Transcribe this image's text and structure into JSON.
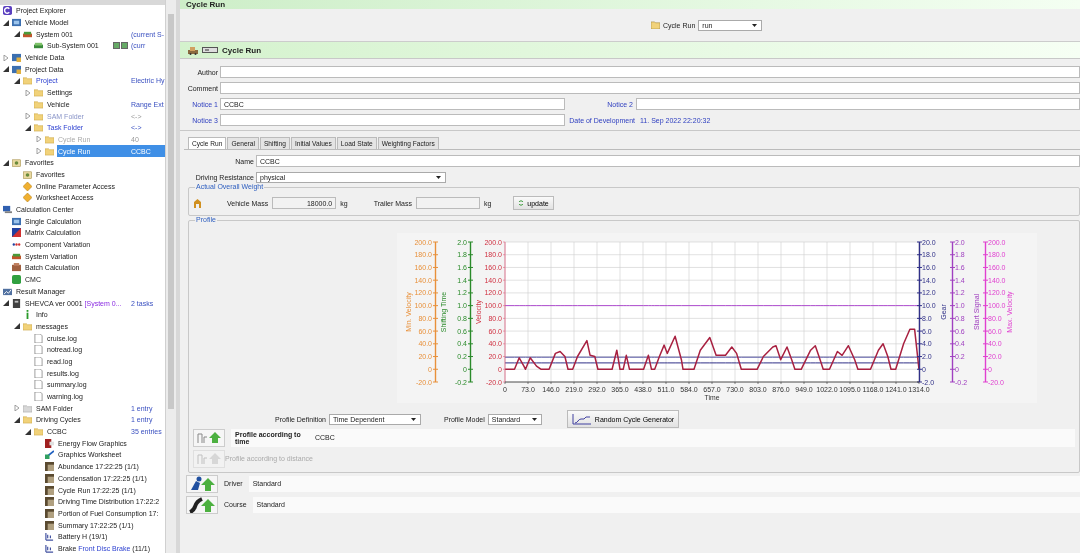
{
  "sidebar": {
    "tree": [
      {
        "kind": "logo",
        "label": "Project Explorer",
        "children": [
          {
            "kind": "model",
            "label": "Vehicle Model",
            "expanded": true,
            "children": [
              {
                "kind": "system",
                "label": "System 001",
                "value": "(current S-",
                "expanded": true,
                "children": [
                  {
                    "kind": "subsystem",
                    "label": "Sub-System 001",
                    "value": "(curr",
                    "value_checks": [
                      true,
                      true
                    ]
                  }
                ]
              }
            ]
          },
          {
            "kind": "data",
            "label": "Vehicle Data",
            "expanded": false
          },
          {
            "kind": "data",
            "label": "Project Data",
            "expanded": true,
            "children": [
              {
                "kind": "folder",
                "label": "Project",
                "link": true,
                "value": "Electric Hy",
                "expanded": true,
                "children": [
                  {
                    "kind": "folder",
                    "label": "Settings",
                    "expanded": false
                  },
                  {
                    "kind": "folder",
                    "label": "Vehicle",
                    "value": "Range Ext"
                  },
                  {
                    "kind": "folder",
                    "label": "SAM Folder",
                    "link": true,
                    "disabled": true,
                    "value": "<->",
                    "expanded": false
                  },
                  {
                    "kind": "folder",
                    "label": "Task Folder",
                    "link": true,
                    "value": "<->",
                    "expanded": true,
                    "children": [
                      {
                        "kind": "folder",
                        "label": "Cycle Run",
                        "disabled": true,
                        "value": "40",
                        "expanded": false,
                        "selected": false
                      },
                      {
                        "kind": "folder",
                        "label": "Cycle Run",
                        "value": "CCBC",
                        "expanded": false,
                        "selected": true
                      }
                    ]
                  }
                ]
              }
            ]
          },
          {
            "kind": "favorites",
            "label": "Favorites",
            "expanded": true,
            "children": [
              {
                "kind": "favorites",
                "label": "Favorites"
              },
              {
                "kind": "diamond",
                "label": "Online Parameter Access"
              },
              {
                "kind": "diamond",
                "label": "Worksheet Access"
              }
            ]
          }
        ]
      },
      {
        "kind": "calc-center",
        "label": "Calculation Center",
        "children": [
          {
            "kind": "model",
            "label": "Single Calculation"
          },
          {
            "kind": "matrix",
            "label": "Matrix Calculation"
          },
          {
            "kind": "variation",
            "label": "Component Variation"
          },
          {
            "kind": "system",
            "label": "System Variation"
          },
          {
            "kind": "batch",
            "label": "Batch Calculation"
          },
          {
            "kind": "cmc",
            "label": "CMC"
          }
        ]
      },
      {
        "kind": "result",
        "label": "Result Manager",
        "children": [
          {
            "kind": "archive",
            "label": "SHEVCA ver 0001",
            "note": "[System 0...",
            "value": "2 tasks",
            "expanded": true,
            "children": [
              {
                "kind": "info",
                "label": "Info"
              },
              {
                "kind": "folder",
                "label": "messages",
                "expanded": true,
                "children": [
                  {
                    "kind": "log",
                    "label": "cruise.log"
                  },
                  {
                    "kind": "log",
                    "label": "notread.log"
                  },
                  {
                    "kind": "log",
                    "label": "read.log"
                  },
                  {
                    "kind": "log",
                    "label": "results.log"
                  },
                  {
                    "kind": "log",
                    "label": "summary.log"
                  },
                  {
                    "kind": "log",
                    "label": "warning.log"
                  }
                ]
              },
              {
                "kind": "grey-folder",
                "label": "SAM Folder",
                "value": "1 entry",
                "expanded": false
              },
              {
                "kind": "folder",
                "label": "Driving Cycles",
                "value": "1 entry",
                "expanded": true,
                "children": [
                  {
                    "kind": "folder",
                    "label": "CCBC",
                    "value": "35 entries",
                    "expanded": true,
                    "children": [
                      {
                        "kind": "energy",
                        "label": "Energy Flow Graphics"
                      },
                      {
                        "kind": "worksheet",
                        "label": "Graphics Worksheet"
                      },
                      {
                        "kind": "image",
                        "label": "Abundance 17:22:25 (1/1)"
                      },
                      {
                        "kind": "image",
                        "label": "Condensation 17:22:25 (1/1)"
                      },
                      {
                        "kind": "image",
                        "label": "Cycle Run 17:22:25 (1/1)"
                      },
                      {
                        "kind": "image",
                        "label": "Driving Time Distribution 17:22:2"
                      },
                      {
                        "kind": "image",
                        "label": "Portion of Fuel Consumption 17:"
                      },
                      {
                        "kind": "image",
                        "label": "Summary 17:22:25 (1/1)"
                      },
                      {
                        "kind": "component",
                        "label": "Battery H (19/1)"
                      },
                      {
                        "kind": "component",
                        "label": "Brake",
                        "note": "Front Disc Brake",
                        "tail": "(11/1)"
                      }
                    ]
                  }
                ]
              }
            ]
          }
        ]
      }
    ]
  },
  "title_bar": {
    "title": "Cycle Run"
  },
  "toolbar": {
    "label": "Cycle Run",
    "select": "run"
  },
  "header": {
    "title": "Cycle Run"
  },
  "fields": [
    {
      "label": "Author"
    },
    {
      "label": "Comment"
    }
  ],
  "notice_rows": [
    {
      "label": "Notice 1",
      "value": "CCBC",
      "side_label": "Notice 2"
    },
    {
      "label": "Notice 3",
      "side_label": "Date of Development",
      "side_text": "11. Sep 2022 22:20:32"
    }
  ],
  "tabs": [
    {
      "label": "Cycle Run",
      "selected": true
    },
    {
      "label": "General",
      "selected": false
    },
    {
      "label": "Shifting",
      "selected": false
    },
    {
      "label": "Initial Values",
      "selected": false
    },
    {
      "label": "Load State",
      "selected": false
    },
    {
      "label": "Weighting Factors",
      "selected": false
    }
  ],
  "cycle_run": {
    "name_label": "Name",
    "name": "CCBC",
    "resistance_label": "Driving Resistance",
    "resistance": "physical",
    "weight": {
      "title": "Actual Overall Weight",
      "vehicle_mass_label": "Vehicle Mass",
      "vehicle_mass": "18000.0",
      "vehicle_unit": "kg",
      "trailer_mass_label": "Trailer Mass",
      "trailer_unit": "kg",
      "update": "update"
    },
    "profile": {
      "title": "Profile",
      "side_axes": [
        {
          "label": "Min. Velocity",
          "color": "#e8903a",
          "right": false,
          "ticks": [
            "200.0",
            "180.0",
            "160.0",
            "140.0",
            "120.0",
            "100.0",
            "80.0",
            "60.0",
            "40.0",
            "20.0",
            "0",
            "-20.0"
          ]
        },
        {
          "label": "Shifting Time",
          "color": "#2a8a2a",
          "right": false,
          "ticks": [
            "2.0",
            "1.8",
            "1.6",
            "1.4",
            "1.2",
            "1.0",
            "0.8",
            "0.6",
            "0.4",
            "0.2",
            "0",
            "-0.2"
          ]
        },
        {
          "label": "Gear",
          "color": "#303088",
          "right": true,
          "ticks": [
            "20.0",
            "18.0",
            "16.0",
            "14.0",
            "12.0",
            "10.0",
            "8.0",
            "6.0",
            "4.0",
            "2.0",
            "0",
            "-2.0"
          ]
        },
        {
          "label": "Start Signal",
          "color": "#a040c0",
          "right": true,
          "ticks": [
            "2.0",
            "1.8",
            "1.6",
            "1.4",
            "1.2",
            "1.0",
            "0.8",
            "0.6",
            "0.4",
            "0.2",
            "0",
            "-0.2"
          ]
        },
        {
          "label": "Max. Velocity",
          "color": "#e040d0",
          "right": true,
          "ticks": [
            "200.0",
            "180.0",
            "160.0",
            "140.0",
            "120.0",
            "100.0",
            "80.0",
            "60.0",
            "40.0",
            "20.0",
            "0",
            "-20.0"
          ]
        }
      ],
      "chart_data": {
        "type": "line",
        "xlabel": "Time",
        "ylabel": "Velocity",
        "xlim": [
          0,
          1314
        ],
        "ylim": [
          -20,
          200
        ],
        "grid": true,
        "xticks": [
          {
            "value": 0,
            "label": "0"
          },
          {
            "value": 73,
            "label": "73.0"
          },
          {
            "value": 146,
            "label": "146.0"
          },
          {
            "value": 219,
            "label": "219.0"
          },
          {
            "value": 292,
            "label": "292.0"
          },
          {
            "value": 365,
            "label": "365.0"
          },
          {
            "value": 438,
            "label": "438.0"
          },
          {
            "value": 511,
            "label": "511.0"
          },
          {
            "value": 584,
            "label": "584.0"
          },
          {
            "value": 657,
            "label": "657.0"
          },
          {
            "value": 730,
            "label": "730.0"
          },
          {
            "value": 803,
            "label": "803.0"
          },
          {
            "value": 876,
            "label": "876.0"
          },
          {
            "value": 949,
            "label": "949.0"
          },
          {
            "value": 1022,
            "label": "1022.0"
          },
          {
            "value": 1095,
            "label": "1095.0"
          },
          {
            "value": 1168,
            "label": "1168.0"
          },
          {
            "value": 1241,
            "label": "1241.0"
          },
          {
            "value": 1314,
            "label": "1314.0"
          }
        ],
        "yticks": [
          {
            "value": -20,
            "label": "-20.0"
          },
          {
            "value": 0,
            "label": "0"
          },
          {
            "value": 20,
            "label": "20.0"
          },
          {
            "value": 40,
            "label": "40.0"
          },
          {
            "value": 60,
            "label": "60.0"
          },
          {
            "value": 80,
            "label": "80.0"
          },
          {
            "value": 100,
            "label": "100.0"
          },
          {
            "value": 120,
            "label": "120.0"
          },
          {
            "value": 140,
            "label": "140.0"
          },
          {
            "value": 160,
            "label": "160.0"
          },
          {
            "value": 180,
            "label": "180.0"
          },
          {
            "value": 200,
            "label": "200.0"
          }
        ],
        "x": [
          0,
          30,
          45,
          60,
          65,
          80,
          100,
          115,
          140,
          160,
          175,
          190,
          200,
          215,
          230,
          260,
          270,
          285,
          295,
          340,
          355,
          365,
          375,
          385,
          395,
          440,
          455,
          465,
          475,
          490,
          505,
          515,
          540,
          560,
          565,
          600,
          620,
          650,
          670,
          700,
          720,
          735,
          750,
          800,
          820,
          850,
          860,
          875,
          895,
          910,
          920,
          940,
          970,
          985,
          1000,
          1010,
          1030,
          1055,
          1070,
          1090,
          1110,
          1120,
          1160,
          1185,
          1200,
          1215,
          1225,
          1240,
          1265,
          1285,
          1300,
          1314
        ],
        "series": [
          {
            "color": "#b050d0",
            "values": [
              100,
              100,
              100,
              100,
              100,
              100,
              100,
              100,
              100,
              100,
              100,
              100,
              100,
              100,
              100,
              100,
              100,
              100,
              100,
              100,
              100,
              100,
              100,
              100,
              100,
              100,
              100,
              100,
              100,
              100,
              100,
              100,
              100,
              100,
              100,
              100,
              100,
              100,
              100,
              100,
              100,
              100,
              100,
              100,
              100,
              100,
              100,
              100,
              100,
              100,
              100,
              100,
              100,
              100,
              100,
              100,
              100,
              100,
              100,
              100,
              100,
              100,
              100,
              100,
              100,
              100,
              100,
              100,
              100,
              100,
              100,
              100
            ]
          },
          {
            "color": "#5050a0",
            "values": [
              19,
              19,
              19,
              19,
              19,
              19,
              19,
              19,
              19,
              19,
              19,
              19,
              19,
              19,
              19,
              19,
              19,
              19,
              19,
              19,
              19,
              19,
              19,
              19,
              19,
              19,
              19,
              19,
              19,
              19,
              19,
              19,
              19,
              19,
              19,
              19,
              19,
              19,
              19,
              19,
              19,
              19,
              19,
              19,
              19,
              19,
              19,
              19,
              19,
              19,
              19,
              19,
              19,
              19,
              19,
              19,
              19,
              19,
              19,
              19,
              19,
              19,
              19,
              19,
              19,
              19,
              19,
              19,
              19,
              19,
              19,
              19
            ]
          },
          {
            "color": "#303088",
            "values": [
              10,
              10,
              10,
              10,
              10,
              10,
              10,
              10,
              10,
              10,
              10,
              10,
              10,
              10,
              10,
              10,
              10,
              10,
              10,
              10,
              10,
              10,
              10,
              10,
              10,
              10,
              10,
              10,
              10,
              10,
              10,
              10,
              10,
              10,
              10,
              10,
              10,
              10,
              10,
              10,
              10,
              10,
              10,
              10,
              10,
              10,
              10,
              10,
              10,
              10,
              10,
              10,
              10,
              10,
              10,
              10,
              10,
              10,
              10,
              10,
              10,
              10,
              10,
              10,
              10,
              10,
              10,
              10,
              10,
              10,
              10,
              10
            ]
          },
          {
            "color": "#a82040",
            "values": [
              0,
              0,
              18,
              5,
              0,
              18,
              5,
              0,
              0,
              25,
              28,
              20,
              0,
              0,
              20,
              45,
              22,
              20,
              0,
              0,
              30,
              0,
              0,
              22,
              0,
              0,
              22,
              0,
              0,
              20,
              38,
              25,
              52,
              15,
              0,
              0,
              30,
              50,
              22,
              22,
              35,
              25,
              0,
              0,
              20,
              35,
              37,
              15,
              35,
              15,
              0,
              0,
              30,
              37,
              15,
              0,
              0,
              28,
              22,
              37,
              15,
              0,
              0,
              30,
              40,
              20,
              0,
              0,
              40,
              63,
              63,
              0
            ]
          }
        ]
      },
      "definition_label": "Profile Definition",
      "definition": "Time Dependent",
      "model_label": "Profile Model",
      "model": "Standard",
      "generator": "Random Cycle Generator",
      "sources": [
        {
          "label": "Profile according to time",
          "value": "CCBC",
          "disabled": false
        },
        {
          "label": "Profile according to distance",
          "disabled": true
        }
      ]
    },
    "components": [
      {
        "kind": "driver",
        "label": "Driver",
        "value": "Standard"
      },
      {
        "kind": "course",
        "label": "Course",
        "value": "Standard"
      }
    ]
  }
}
